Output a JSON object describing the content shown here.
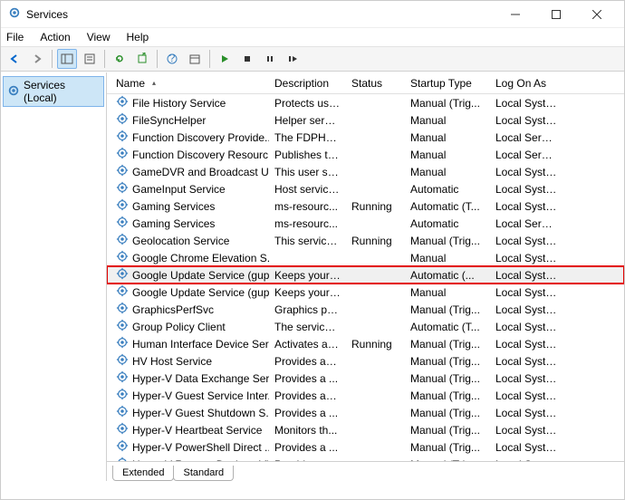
{
  "window": {
    "title": "Services"
  },
  "menu": {
    "file": "File",
    "action": "Action",
    "view": "View",
    "help": "Help"
  },
  "tree": {
    "root": "Services (Local)"
  },
  "columns": {
    "name": "Name",
    "desc": "Description",
    "status": "Status",
    "startup": "Startup Type",
    "logon": "Log On As"
  },
  "tabs": {
    "extended": "Extended",
    "standard": "Standard"
  },
  "highlight_index": 9,
  "services": [
    {
      "name": "File History Service",
      "desc": "Protects use...",
      "status": "",
      "startup": "Manual (Trig...",
      "logon": "Local Syste..."
    },
    {
      "name": "FileSyncHelper",
      "desc": "Helper servi...",
      "status": "",
      "startup": "Manual",
      "logon": "Local Syste..."
    },
    {
      "name": "Function Discovery Provide...",
      "desc": "The FDPHO...",
      "status": "",
      "startup": "Manual",
      "logon": "Local Service"
    },
    {
      "name": "Function Discovery Resourc...",
      "desc": "Publishes th...",
      "status": "",
      "startup": "Manual",
      "logon": "Local Service"
    },
    {
      "name": "GameDVR and Broadcast Us...",
      "desc": "This user ser...",
      "status": "",
      "startup": "Manual",
      "logon": "Local Syste..."
    },
    {
      "name": "GameInput Service",
      "desc": "Host service...",
      "status": "",
      "startup": "Automatic",
      "logon": "Local Syste..."
    },
    {
      "name": "Gaming Services",
      "desc": "ms-resourc...",
      "status": "Running",
      "startup": "Automatic (T...",
      "logon": "Local Syste..."
    },
    {
      "name": "Gaming Services",
      "desc": "ms-resourc...",
      "status": "",
      "startup": "Automatic",
      "logon": "Local Service"
    },
    {
      "name": "Geolocation Service",
      "desc": "This service ...",
      "status": "Running",
      "startup": "Manual (Trig...",
      "logon": "Local Syste..."
    },
    {
      "name": "Google Chrome Elevation S...",
      "desc": "",
      "status": "",
      "startup": "Manual",
      "logon": "Local Syste..."
    },
    {
      "name": "Google Update Service (gup...",
      "desc": "Keeps your ...",
      "status": "",
      "startup": "Automatic (...",
      "logon": "Local Syste..."
    },
    {
      "name": "Google Update Service (gup...",
      "desc": "Keeps your ...",
      "status": "",
      "startup": "Manual",
      "logon": "Local Syste..."
    },
    {
      "name": "GraphicsPerfSvc",
      "desc": "Graphics pe...",
      "status": "",
      "startup": "Manual (Trig...",
      "logon": "Local Syste..."
    },
    {
      "name": "Group Policy Client",
      "desc": "The service i...",
      "status": "",
      "startup": "Automatic (T...",
      "logon": "Local Syste..."
    },
    {
      "name": "Human Interface Device Ser...",
      "desc": "Activates an...",
      "status": "Running",
      "startup": "Manual (Trig...",
      "logon": "Local Syste..."
    },
    {
      "name": "HV Host Service",
      "desc": "Provides an ...",
      "status": "",
      "startup": "Manual (Trig...",
      "logon": "Local Syste..."
    },
    {
      "name": "Hyper-V Data Exchange Ser...",
      "desc": "Provides a ...",
      "status": "",
      "startup": "Manual (Trig...",
      "logon": "Local Syste..."
    },
    {
      "name": "Hyper-V Guest Service Inter...",
      "desc": "Provides an ...",
      "status": "",
      "startup": "Manual (Trig...",
      "logon": "Local Syste..."
    },
    {
      "name": "Hyper-V Guest Shutdown S...",
      "desc": "Provides a ...",
      "status": "",
      "startup": "Manual (Trig...",
      "logon": "Local Syste..."
    },
    {
      "name": "Hyper-V Heartbeat Service",
      "desc": "Monitors th...",
      "status": "",
      "startup": "Manual (Trig...",
      "logon": "Local Syste..."
    },
    {
      "name": "Hyper-V PowerShell Direct ...",
      "desc": "Provides a ...",
      "status": "",
      "startup": "Manual (Trig...",
      "logon": "Local Syste..."
    },
    {
      "name": "Hyper-V Remote Desktop Vi...",
      "desc": "Provides a p...",
      "status": "",
      "startup": "Manual (Trig...",
      "logon": "Local Syste..."
    }
  ]
}
